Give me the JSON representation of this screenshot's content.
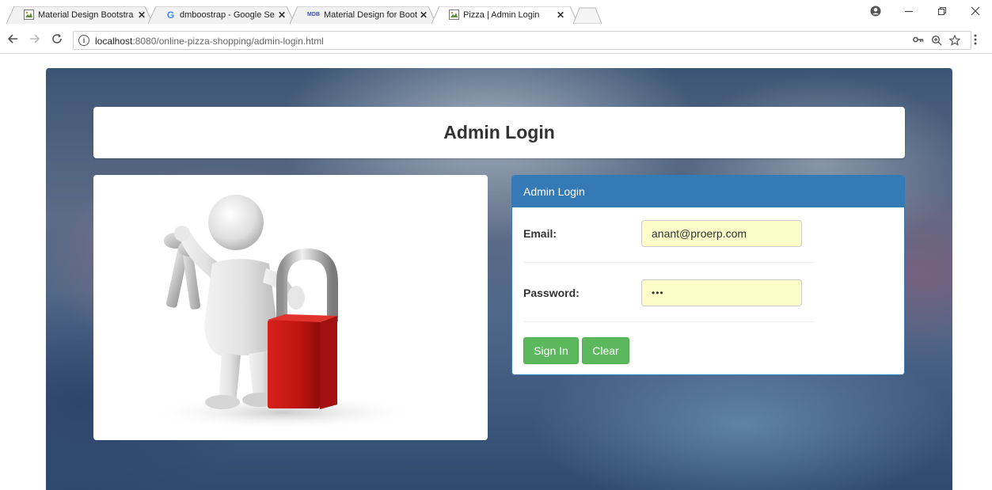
{
  "browser": {
    "tabs": [
      {
        "title": "Material Design Bootstra",
        "favicon": "image-icon",
        "active": false
      },
      {
        "title": "dmboostrap - Google Se",
        "favicon": "google-icon",
        "active": false
      },
      {
        "title": "Material Design for Boot",
        "favicon": "mdb-icon",
        "active": false
      },
      {
        "title": "Pizza | Admin Login",
        "favicon": "image-icon",
        "active": true
      }
    ],
    "tab_close_glyph": "✕",
    "url_host": "localhost",
    "url_path": ":8080/online-pizza-shopping/admin-login.html",
    "mdb_favicon_text": "MDB",
    "google_favicon_text": "G"
  },
  "page": {
    "heading": "Admin Login",
    "login_panel": {
      "title": "Admin Login",
      "email_label": "Email:",
      "email_value": "anant@proerp.com",
      "password_label": "Password:",
      "password_value": "•••",
      "sign_in_label": "Sign In",
      "clear_label": "Clear"
    }
  },
  "colors": {
    "panel_primary": "#337ab7",
    "button_success": "#5cb85c",
    "autofill_yellow": "#fbfcc8"
  }
}
